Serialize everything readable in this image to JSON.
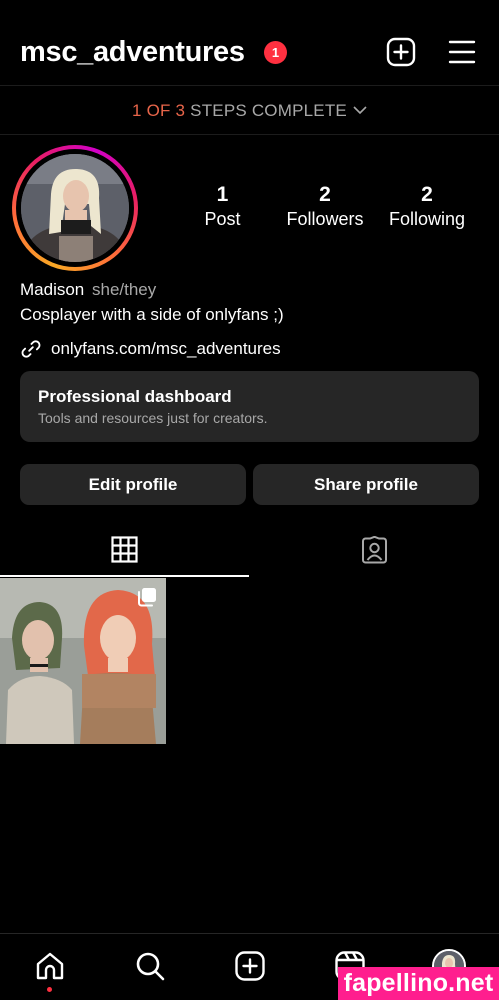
{
  "header": {
    "username": "msc_adventures",
    "notification_count": "1"
  },
  "setup": {
    "progress_done": "1 OF 3",
    "progress_rest": "STEPS COMPLETE",
    "steps_completed": 1,
    "steps_total": 3
  },
  "stats": [
    {
      "value": "1",
      "label": "Post"
    },
    {
      "value": "2",
      "label": "Followers"
    },
    {
      "value": "2",
      "label": "Following"
    }
  ],
  "bio": {
    "name": "Madison",
    "pronouns": "she/they",
    "text": "Cosplayer with a side of onlyfans ;)",
    "link": "onlyfans.com/msc_adventures"
  },
  "dashboard": {
    "title": "Professional dashboard",
    "subtitle": "Tools and resources just for creators."
  },
  "actions": {
    "edit": "Edit profile",
    "share": "Share profile"
  },
  "tabs": [
    {
      "icon": "grid-icon",
      "active": true
    },
    {
      "icon": "tagged-icon",
      "active": false
    }
  ],
  "nav": [
    "home-icon",
    "search-icon",
    "create-icon",
    "reels-icon",
    "profile-avatar"
  ],
  "watermark": "fapellino.net",
  "colors": {
    "background": "#000000",
    "surface": "#262626",
    "badge": "#ff3040",
    "progress_accent": "#e8654a",
    "watermark": "#ff1e8e"
  }
}
